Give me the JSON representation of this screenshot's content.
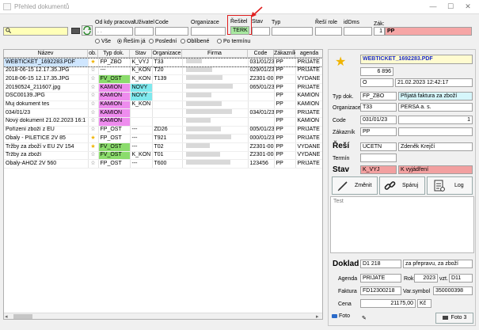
{
  "window": {
    "title": "Přehled dokumentů",
    "min": "—",
    "max": "☐",
    "close": "✕"
  },
  "filters": {
    "od_kdy_label": "Od kdy pracoval",
    "uzivatel_label": "Uživatel",
    "code_label": "Code",
    "organizace_label": "Organizace",
    "resitel_label": "Řešitel",
    "resitel_value": "TERK",
    "stav_label": "Stav",
    "typ_label": "Typ",
    "resi_role_label": "Řeší role",
    "iddms_label": "idDms",
    "zak_label": "Zák:",
    "zak_num": "1",
    "zak_value": "PP",
    "radios": [
      "Vše",
      "Řeším já",
      "Poslední",
      "Oblíbené",
      "Po termínu"
    ],
    "radio_selected": 1
  },
  "grid": {
    "headers": [
      "Název",
      "ob.",
      "Typ dok.",
      "Stav",
      "Organizace",
      "Firma",
      "Code",
      "Zákazník",
      "agenda"
    ],
    "rows": [
      {
        "nazev": "WEBTICKET_1692283.PDF",
        "fav": true,
        "typ": "FP_ZBO",
        "typ_color": "",
        "stav": "K_VYJ",
        "stav_color": "",
        "org": "T33",
        "firma": "",
        "code": "031/01/23",
        "zak": "PP",
        "agenda": "PRIJATE",
        "selected": true
      },
      {
        "nazev": "2018-06-15 12.17.35.JPG",
        "fav": false,
        "typ": "---",
        "typ_color": "",
        "stav": "K_KON",
        "stav_color": "",
        "org": "T20",
        "firma": "",
        "code": "029/01/23",
        "zak": "PP",
        "agenda": "PRIJATE"
      },
      {
        "nazev": "2018-06-15 12.17.35.JPG",
        "fav": false,
        "typ": "FV_OST",
        "typ_color": "cg",
        "stav": "K_KON",
        "stav_color": "",
        "org": "T139",
        "firma": "",
        "code": "Z2301-0034",
        "zak": "PP",
        "agenda": "VYDANE"
      },
      {
        "nazev": "20190524_211607.jpg",
        "fav": false,
        "typ": "KAMION",
        "typ_color": "cm",
        "stav": "NOVY",
        "stav_color": "cc",
        "org": "",
        "firma": "",
        "code": "065/01/23",
        "zak": "PP",
        "agenda": "PRIJATE"
      },
      {
        "nazev": "DSC00139.JPG",
        "fav": false,
        "typ": "KAMION",
        "typ_color": "cm",
        "stav": "NOVY",
        "stav_color": "cc",
        "org": "",
        "firma": "",
        "code": "",
        "zak": "PP",
        "agenda": "KAMION"
      },
      {
        "nazev": "Muj dokument tes",
        "fav": false,
        "typ": "KAMION",
        "typ_color": "cm",
        "stav": "K_KON",
        "stav_color": "",
        "org": "",
        "firma": "",
        "code": "",
        "zak": "PP",
        "agenda": "KAMION"
      },
      {
        "nazev": "034/01/23",
        "fav": false,
        "typ": "KAMION",
        "typ_color": "cm",
        "stav": "",
        "stav_color": "",
        "org": "",
        "firma": "",
        "code": "034/01/23",
        "zak": "PP",
        "agenda": "PRIJATE"
      },
      {
        "nazev": "Nový dokument 21.02.2023 16:1",
        "fav": false,
        "typ": "KAMION",
        "typ_color": "cm",
        "stav": "",
        "stav_color": "",
        "org": "",
        "firma": "",
        "code": "",
        "zak": "PP",
        "agenda": "KAMION"
      },
      {
        "nazev": "Pořízení zboží z EU",
        "fav": false,
        "typ": "FP_OST",
        "typ_color": "",
        "stav": "---",
        "stav_color": "",
        "org": "ZD26",
        "firma": "",
        "code": "005/01/23",
        "zak": "PP",
        "agenda": "PRIJATE"
      },
      {
        "nazev": "Obaly - PILETICE 2V  85",
        "fav": true,
        "typ": "FP_OST",
        "typ_color": "",
        "stav": "---",
        "stav_color": "",
        "org": "T921",
        "firma": "",
        "code": "000/01/23",
        "zak": "PP",
        "agenda": "PRIJATE"
      },
      {
        "nazev": "Tržby za zboží v EU 2V  154",
        "fav": true,
        "typ": "FV_OST",
        "typ_color": "cg",
        "stav": "---",
        "stav_color": "",
        "org": "T02",
        "firma": "",
        "code": "Z2301-0034",
        "zak": "PP",
        "agenda": "VYDANE"
      },
      {
        "nazev": "Tržby za zboží",
        "fav": false,
        "typ": "FV_OST",
        "typ_color": "cg",
        "stav": "K_KON",
        "stav_color": "",
        "org": "T01",
        "firma": "",
        "code": "Z2301-0034",
        "zak": "PP",
        "agenda": "VYDANE"
      },
      {
        "nazev": "Obaly-AHOZ 2V  560",
        "fav": false,
        "typ": "FP_OST",
        "typ_color": "",
        "stav": "---",
        "stav_color": "",
        "org": "T600",
        "firma": "",
        "code": "123456",
        "zak": "PP",
        "agenda": "PRIJATE"
      }
    ]
  },
  "detail": {
    "filename": "WEBTICKET_1692283.PDF",
    "number": "6 896",
    "state_code": "O",
    "datetime": "21.02.2023 12:42:17",
    "typ_dok_label": "Typ dok.",
    "typ_dok_code": "FP_ZBO",
    "typ_dok_name": "Přijatá faktura za zboží",
    "org_label": "Organizace",
    "org_code": "T33",
    "org_name": "PERSA a. s.",
    "code_label": "Code",
    "code_value": "031/01/23",
    "code_num": "1",
    "zakaznik_label": "Zákazník",
    "zakaznik_value": "PP",
    "resi_label": "Řeší",
    "resi_role": "UCETN",
    "resi_person": "Zdeněk Krejčí",
    "termin_label": "Termín",
    "stav_label": "Stav",
    "stav_code": "K_VYJ",
    "stav_name": "K vyjádření",
    "btn_zmenit": "Změnit",
    "btn_sparuj": "Spáruj",
    "btn_log": "Log",
    "note": "Test",
    "doklad_label": "Doklad",
    "doklad_value": "D1 218",
    "doklad_desc": "za přepravu, za zboží",
    "agenda_label": "Agenda",
    "agenda_value": "PRIJATE",
    "rok_label": "Rok",
    "rok_value": "2023",
    "vzt_label": "vzt.",
    "vzt_value": "D11",
    "faktura_label": "Faktura",
    "faktura_value": "FD12300218",
    "varsym_label": "Var.symbol",
    "varsym_value": "350000398",
    "cena_label": "Cena",
    "cena_value": "21175,00",
    "cena_curr": "Kč",
    "foto_label": "Foto",
    "foto3_label": "Foto 3"
  }
}
